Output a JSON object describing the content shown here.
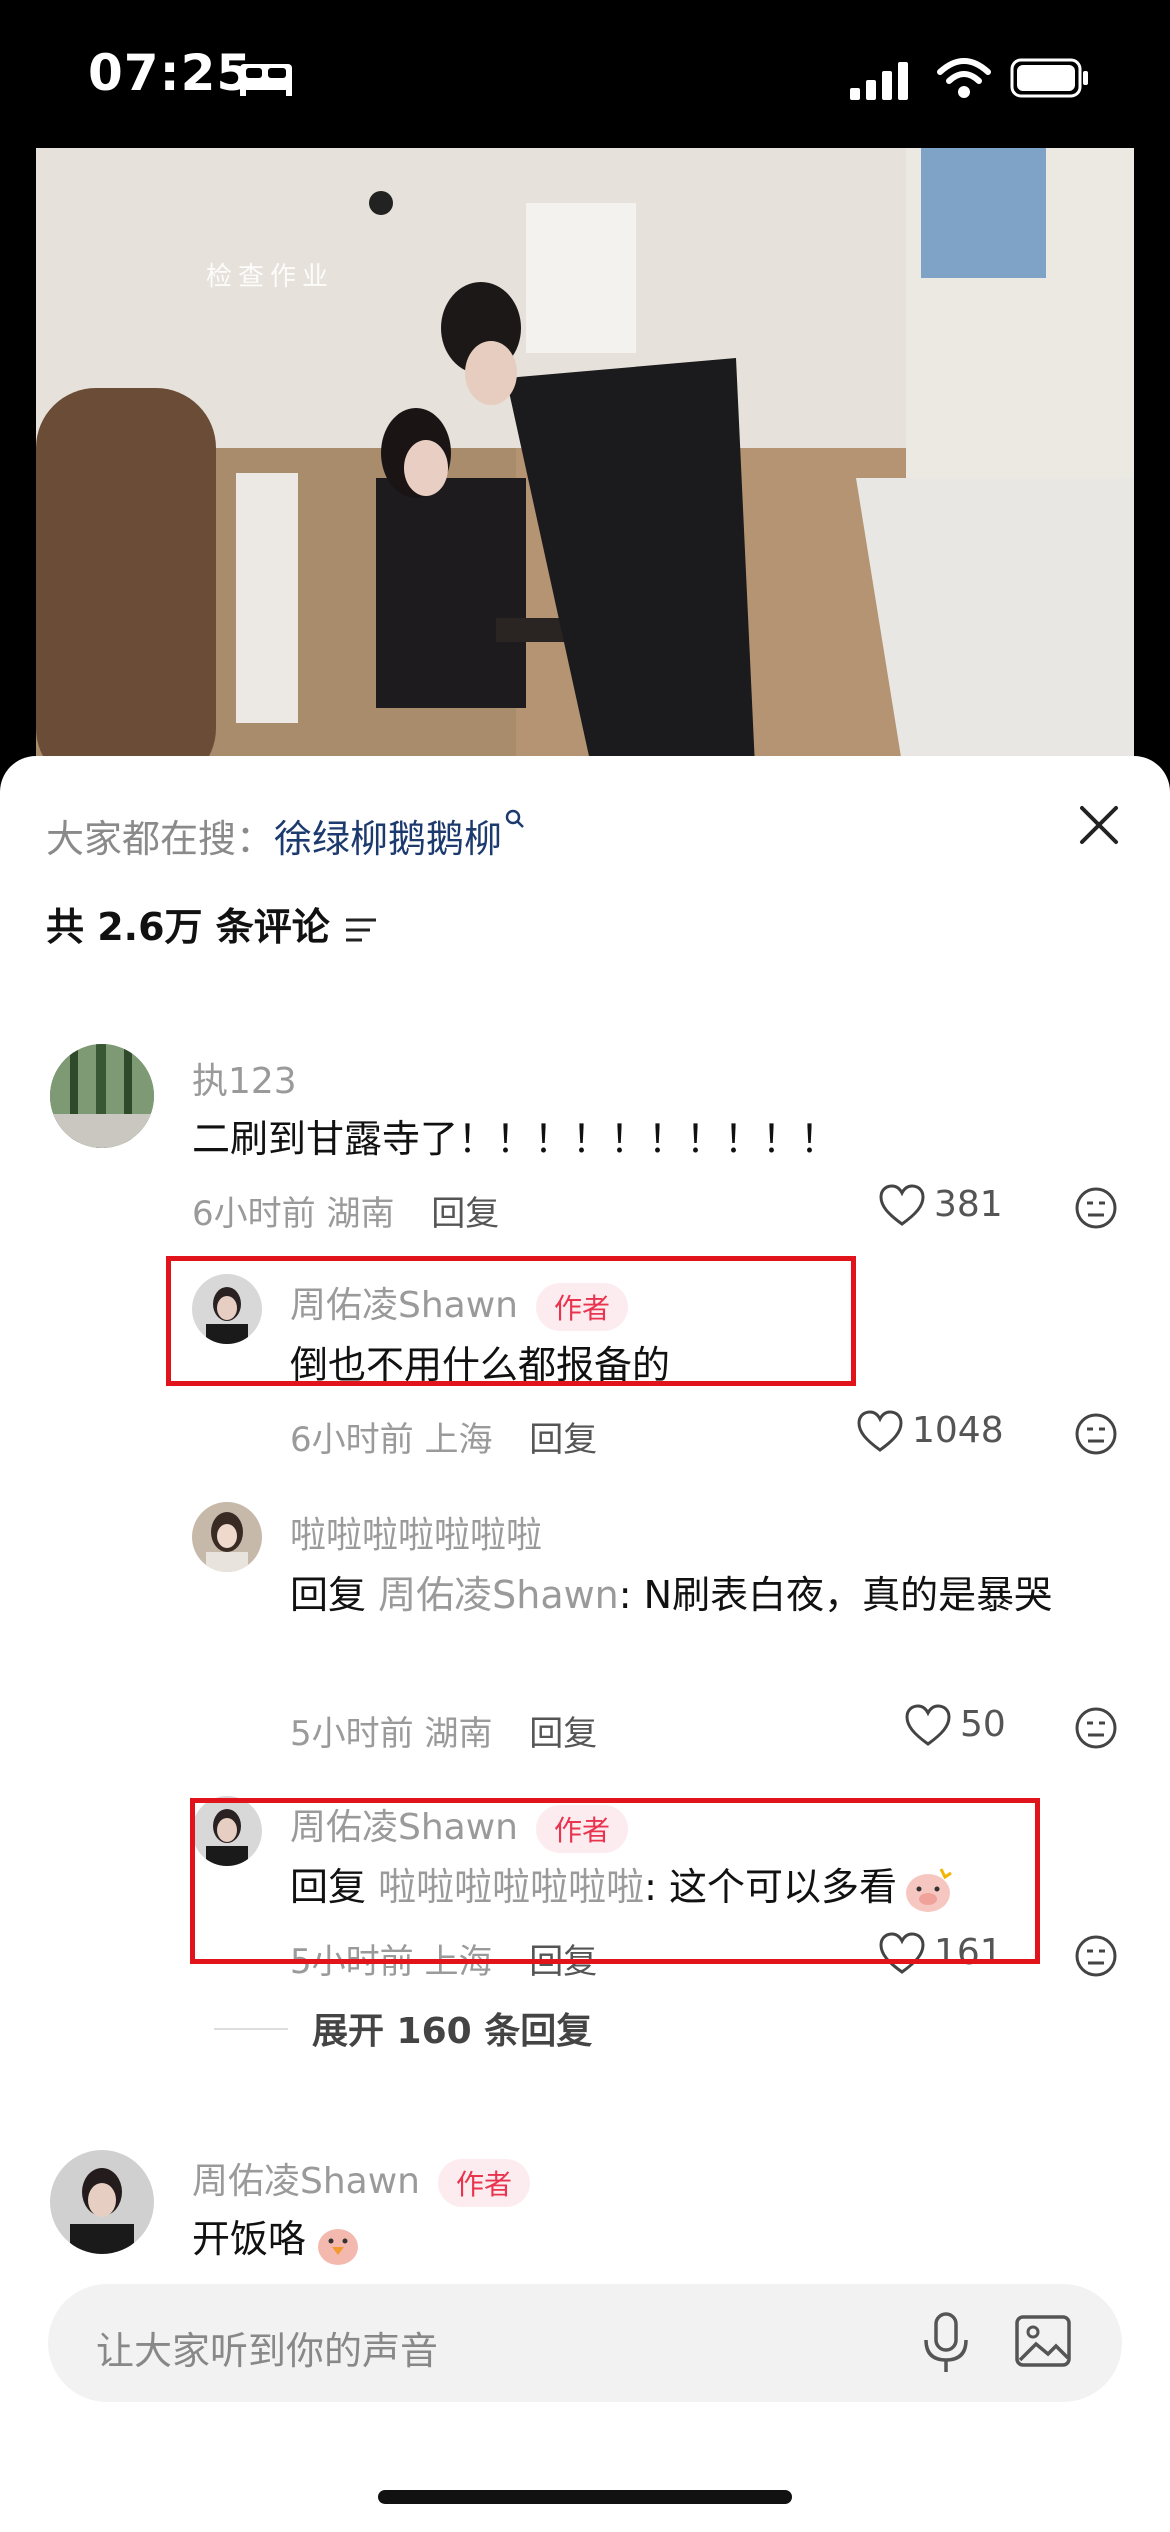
{
  "status_bar": {
    "time": "07:25",
    "bed_icon": "bed-icon",
    "signal_icon": "signal-icon",
    "wifi_icon": "wifi-icon",
    "battery_icon": "battery-icon"
  },
  "video": {
    "watermark": "检查作业"
  },
  "search": {
    "prefix": "大家都在搜：",
    "query": "徐绿柳鹅鹅柳"
  },
  "comments_header": {
    "count_text": "共 2.6万 条评论"
  },
  "comments": [
    {
      "author": "执123",
      "text": "二刷到甘露寺了！！！！！！！！！！",
      "time": "6小时前",
      "location": "湖南",
      "reply_label": "回复",
      "likes": "381",
      "replies": [
        {
          "author": "周佑凌Shawn",
          "badge": "作者",
          "text": "倒也不用什么都报备的",
          "time": "6小时前",
          "location": "上海",
          "reply_label": "回复",
          "likes": "1048"
        },
        {
          "author": "啦啦啦啦啦啦啦",
          "reply_prefix": "回复",
          "mention": "周佑凌Shawn",
          "text": ": N刷表白夜，真的是暴哭",
          "time": "5小时前",
          "location": "湖南",
          "reply_label": "回复",
          "likes": "50"
        },
        {
          "author": "周佑凌Shawn",
          "badge": "作者",
          "reply_prefix": "回复",
          "mention": "啦啦啦啦啦啦啦",
          "text": ": 这个可以多看",
          "time": "5小时前",
          "location": "上海",
          "reply_label": "回复",
          "likes": "161"
        }
      ],
      "expand_label": "展开 160 条回复"
    },
    {
      "author": "周佑凌Shawn",
      "badge": "作者",
      "text": "开饭咯"
    }
  ],
  "input": {
    "placeholder": "让大家听到你的声音"
  },
  "colors": {
    "accent_link": "#1d3a6e",
    "author_badge": "#e8344e",
    "highlight_box": "#e1141c"
  }
}
